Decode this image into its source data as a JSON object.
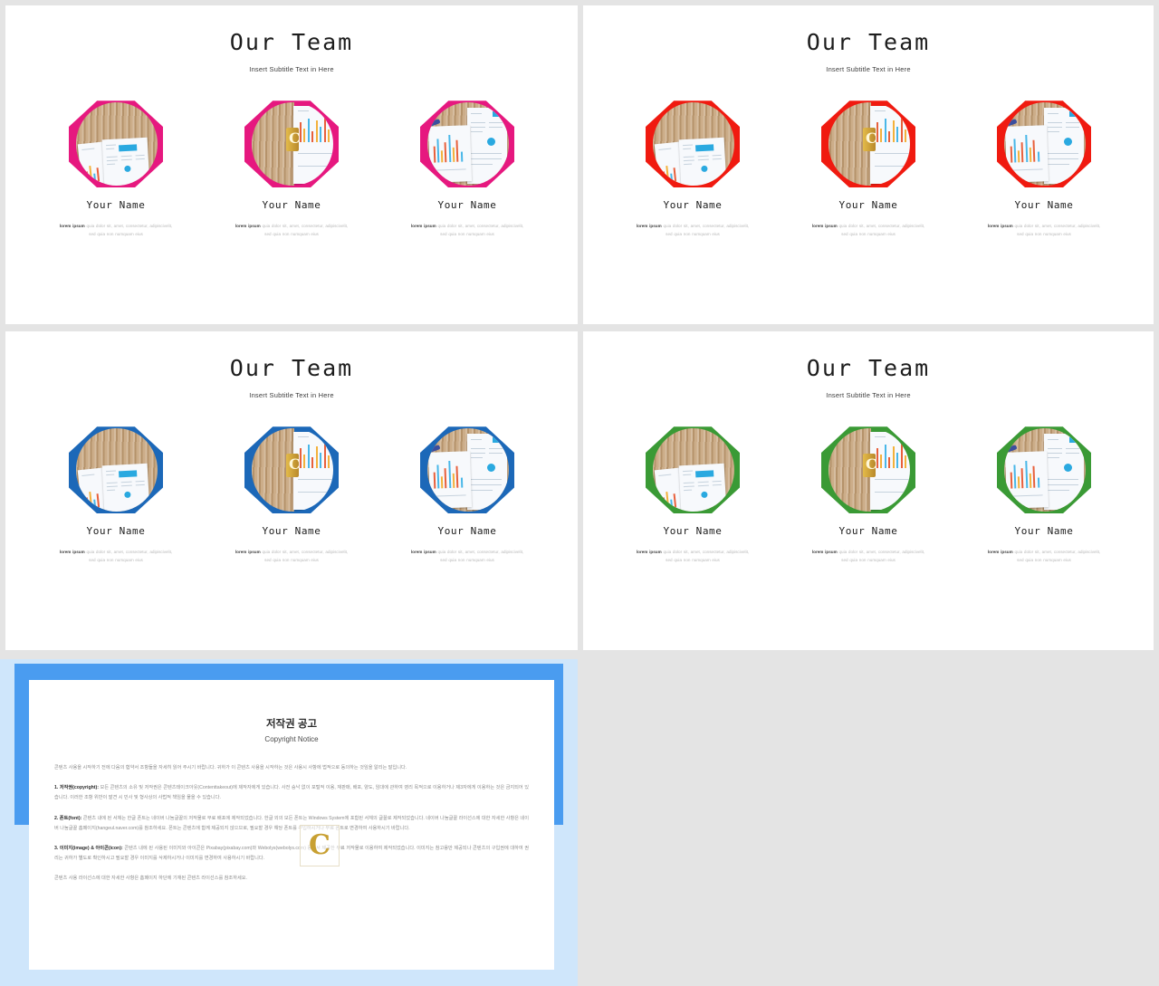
{
  "deck": {
    "title": "Our Team",
    "subtitle": "Insert Subtitle Text in Here",
    "member_name": "Your Name",
    "member_desc_bold": "lorem ipsum",
    "member_desc_rest": " quia dolor sit, amet, consectetur, adipiscivelit, sed quia non numquam eius"
  },
  "slides": [
    {
      "id": "slide-pink",
      "accent": "#e6187f",
      "variant": "Pink"
    },
    {
      "id": "slide-red",
      "accent": "#f01a10",
      "variant": "Red"
    },
    {
      "id": "slide-blue",
      "accent": "#1c68b8",
      "variant": "Blue"
    },
    {
      "id": "slide-green",
      "accent": "#3a9a35",
      "variant": "Green"
    }
  ],
  "copyright": {
    "frame_color": "#4a9cf0",
    "backdrop_color": "#cfe6fb",
    "title_ko": "저작권 공고",
    "title_en": "Copyright Notice",
    "watermark": "C",
    "intro": "콘텐츠 사용을 시작하기 전에 다음의 협약서 조항들을 자세히 읽어 주시기 바랍니다. 귀하가 이 콘텐츠 사용을 시작하는 것은 사용시 사항에 법적으로 동의하는 것임을 알리는 말입니다.",
    "sections": [
      {
        "label": "1. 저작권(copyright):",
        "text": " 모든 콘텐츠의 소유 및 저작권은 콘텐츠테이크아웃(Contenttakeout)에 제작자에게 있습니다. 사전 승낙 없이 포털적 이용, 재판매, 배포, 양도, 임대에 관하여 영리 목적으로 이용하거나 제3자에게 이용하는 것은 금지되어 있습니다. 이러한 조항 위반이 발견 시 민사 및 형사상의 사법적 책임을 물을 수 있습니다."
      },
      {
        "label": "2. 폰트(font):",
        "text": " 콘텐츠 내에 된 서체는 한글 폰트는 네이버 나눔글꼴의 저작물로 무료 배포에 제작되었습니다. 한글 외의 모든 폰트는 Windows System에 포함된 서체의 글꼴로 제작되었습니다. 네이버 나눔글꼴 라이선스에 대한 자세한 사항은 네이버 나눔글꼴 홈페이지(hangeul.naver.com)를 참조하세요. 폰트는 콘텐츠에 함께 제공되지 않으므로, 필요할 경우 해당 폰트를 구입하시거나 무료 폰트로 변경하여 사용하시기 바랍니다."
      },
      {
        "label": "3. 이미지(image) & 아이콘(icon):",
        "text": " 콘텐츠 내에 된 사용된 이미지와 아이콘은 Pixabay(pixabay.com)와 Webolys(webolys.com) 등에서 제공한 무료 저작물로 이용하여 제작되었습니다. 이미지는 참고용만 제공되나 콘텐츠의 구입권에 대하여 권리는 귀하가 별도로 확인하시고 필요할 경우 이미지를 삭제하시거나 이미지를 변경하여 사용하시기 바랍니다."
      }
    ],
    "footer": "콘텐츠 사용 라이선스에 대한 자세한 사항은 홈페이지 하단에 기재된 콘텐츠 라이선스를 참조하세요."
  }
}
